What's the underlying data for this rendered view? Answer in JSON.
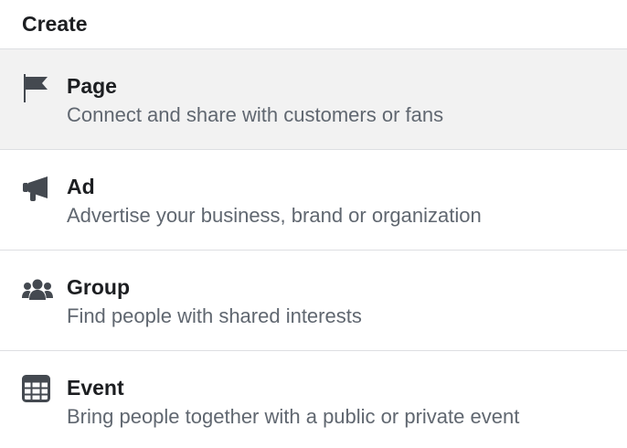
{
  "header": {
    "title": "Create"
  },
  "items": [
    {
      "title": "Page",
      "description": "Connect and share with customers or fans",
      "icon": "flag-icon"
    },
    {
      "title": "Ad",
      "description": "Advertise your business, brand or organization",
      "icon": "megaphone-icon"
    },
    {
      "title": "Group",
      "description": "Find people with shared interests",
      "icon": "group-icon"
    },
    {
      "title": "Event",
      "description": "Bring people together with a public or private event",
      "icon": "calendar-icon"
    }
  ],
  "colors": {
    "title": "#1c1e21",
    "description": "#606770",
    "icon": "#444950",
    "divider": "#dddfe2",
    "hover_background": "#f2f2f2"
  }
}
